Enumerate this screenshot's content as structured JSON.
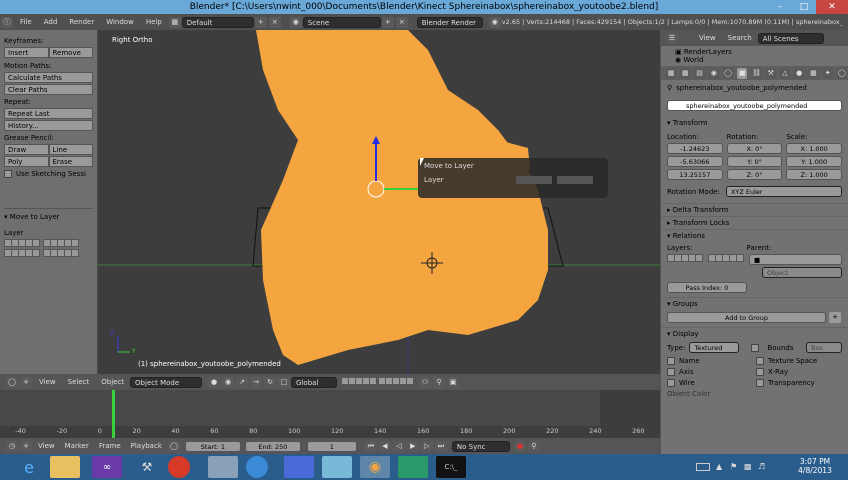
{
  "window": {
    "title": "Blender* [C:\\Users\\nwint_000\\Documents\\Blender\\Kinect Sphereinabox\\sphereinabox_youtoobe2.blend]",
    "controls": [
      "–",
      "□",
      "✕"
    ]
  },
  "info": {
    "menus": [
      "File",
      "Add",
      "Render",
      "Window",
      "Help"
    ],
    "screen": "Default",
    "scene": "Scene",
    "engine": "Blender Render",
    "stats": "v2.65 | Verts:214468 | Faces:429154 | Objects:1/2 | Lamps:0/0 | Mem:1070.89M (0.11M) | sphereinabox_youtoo"
  },
  "toolshelf": {
    "keyframes": "Keyframes:",
    "insert": "Insert",
    "remove": "Remove",
    "motion": "Motion Paths:",
    "calc": "Calculate Paths",
    "clear": "Clear Paths",
    "repeat": "Repeat:",
    "repeat_last": "Repeat Last",
    "history": "History...",
    "grease": "Grease Pencil:",
    "draw": "Draw",
    "line": "Line",
    "poly": "Poly",
    "erase": "Erase",
    "sketch": "Use Sketching Sessi",
    "op_title": "Move to Layer",
    "layer": "Layer"
  },
  "viewport": {
    "view_label": "Right Ortho",
    "object_label": "(1) sphereinabox_youtoobe_polymended",
    "popup_title": "Move to Layer",
    "popup_layer": "Layer",
    "axis_y": "Y",
    "axis_z": "Z"
  },
  "vpheader": {
    "view": "View",
    "select": "Select",
    "object": "Object",
    "mode": "Object Mode",
    "pivot": "Global"
  },
  "timeline": {
    "ticks": [
      "-40",
      "-20",
      "0",
      "20",
      "40",
      "60",
      "80",
      "100",
      "120",
      "140",
      "160",
      "180",
      "200",
      "220",
      "240",
      "260"
    ]
  },
  "tlbar": {
    "view": "View",
    "marker": "Marker",
    "frame": "Frame",
    "playback": "Playback",
    "start": "Start: 1",
    "end": "End: 250",
    "current": "1",
    "sync": "No Sync"
  },
  "props": {
    "tabs": [
      "View",
      "Search",
      "All Scenes"
    ],
    "outliner": [
      "RenderLayers",
      "World"
    ],
    "context": "sphereinabox_youtoobe_polymended",
    "name": "sphereinabox_youtoobe_polymended",
    "transform": "Transform",
    "location": "Location:",
    "rotation": "Rotation:",
    "scale": "Scale:",
    "loc": [
      "-1.24623",
      "-5.63066",
      "13.25157"
    ],
    "rot": [
      "X: 0°",
      "Y: 0°",
      "Z: 0°"
    ],
    "scl": [
      "X: 1.000",
      "Y: 1.000",
      "Z: 1.000"
    ],
    "rotmode_label": "Rotation Mode:",
    "rotmode": "XYZ Euler",
    "delta": "Delta Transform",
    "locks": "Transform Locks",
    "relations": "Relations",
    "layers": "Layers:",
    "parent": "Parent:",
    "parent_type": "Object",
    "pass_index": "Pass Index: 0",
    "groups": "Groups",
    "add_group": "Add to Group",
    "display": "Display",
    "type_label": "Type:",
    "type": "Textured",
    "bounds": "Bounds",
    "box": "Box",
    "checks_left": [
      "Name",
      "Axis",
      "Wire"
    ],
    "checks_right": [
      "Texture Space",
      "X-Ray",
      "Transparency"
    ],
    "object_color": "Object Color"
  },
  "taskbar": {
    "time": "3:07 PM",
    "date": "4/8/2013"
  },
  "colors": {
    "mesh": "#f5a540",
    "accent": "#6aa8d8",
    "taskbar": "#2a5c8c"
  }
}
